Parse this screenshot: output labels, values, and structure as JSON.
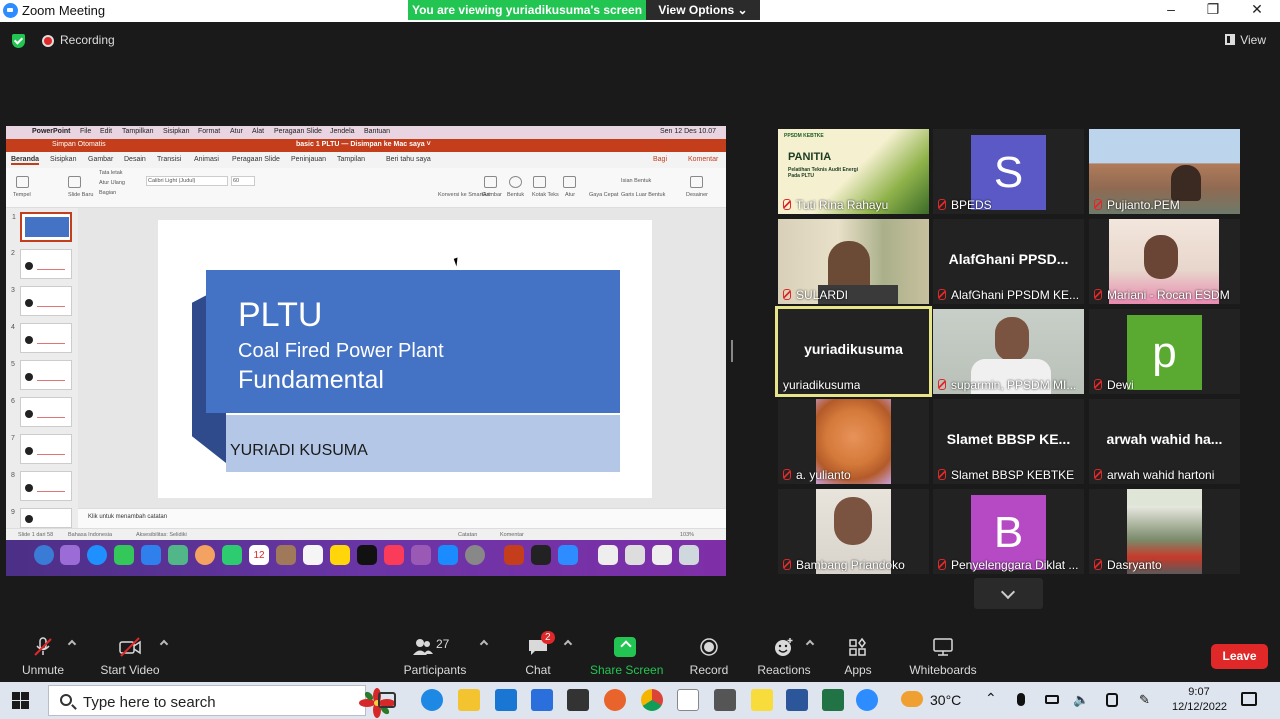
{
  "window": {
    "title": "Zoom Meeting"
  },
  "share_banner": {
    "text": "You are viewing yuriadikusuma's screen",
    "view_options": "View Options ⌄"
  },
  "window_controls": {
    "minimize": "–",
    "maximize": "❐",
    "close": "✕"
  },
  "recording": {
    "label": "Recording"
  },
  "view_button": {
    "label": "View"
  },
  "shared_screen": {
    "mac_menu": [
      "PowerPoint",
      "File",
      "Edit",
      "Tampilkan",
      "Sisipkan",
      "Format",
      "Atur",
      "Alat",
      "Peragaan Slide",
      "Jendela",
      "Bantuan"
    ],
    "mac_clock": "Sen 12 Des  10.07",
    "doc_title": "basic 1 PLTU — Disimpan ke Mac saya ˅",
    "autosave": "Simpan Otomatis",
    "ribbon_tabs": [
      "Beranda",
      "Sisipkan",
      "Gambar",
      "Desain",
      "Transisi",
      "Animasi",
      "Peragaan Slide",
      "Peninjauan",
      "Tampilan",
      "Beri tahu saya"
    ],
    "share_btn": "Bagi",
    "comment_btn": "Komentar",
    "ribbon_labels": [
      "Tempel",
      "Slide Baru",
      "Tata letak",
      "Atur Ulang",
      "Bagian",
      "Calibri Light (Judul)",
      "60",
      "Konversi ke SmartArt",
      "Gambar",
      "Bentuk",
      "Kotak Teks",
      "Atur",
      "Gaya Cepat",
      "Isian Bentuk",
      "Garis Luar Bentuk",
      "Desainer"
    ],
    "slide": {
      "title": "PLTU",
      "subtitle1": "Coal Fired Power Plant",
      "subtitle2": "Fundamental",
      "author": "YURIADI KUSUMA"
    },
    "notes_placeholder": "Klik untuk menambah catatan",
    "status": {
      "slide_count": "Slide 1 dari 58",
      "language": "Bahasa Indonesia",
      "accessibility": "Aksesibilitas: Selidiki",
      "notes": "Catatan",
      "comments": "Komentar",
      "zoom": "103%"
    },
    "thumbnail_numbers": [
      "1",
      "2",
      "3",
      "4",
      "5",
      "6",
      "7",
      "8",
      "9"
    ],
    "dock_calendar": "12"
  },
  "participants_gallery": [
    {
      "name": "Tuti Rina Rahayu",
      "type": "photo",
      "poster_title": "PANITIA",
      "poster_sub": "Pelatihan Teknis Audit Energi Pada PLTU",
      "poster_org": "PPSDM KEBTKE"
    },
    {
      "name": "BPEDS",
      "type": "avatar",
      "letter": "S",
      "color": "#5a59c6"
    },
    {
      "name": "Pujianto.PEM",
      "type": "photo"
    },
    {
      "name": "SULARDI",
      "type": "photo"
    },
    {
      "name": "AlafGhani PPSDM KE...",
      "type": "text",
      "display": "AlafGhani  PPSD..."
    },
    {
      "name": "Mariani - Rocan ESDM",
      "type": "photo"
    },
    {
      "name": "yuriadikusuma",
      "type": "text",
      "display": "yuriadikusuma",
      "speaking": true
    },
    {
      "name": "suparmin, PPSDM MI...",
      "type": "photo"
    },
    {
      "name": "Dewi",
      "type": "avatar",
      "letter": "p",
      "color": "#5aaa32"
    },
    {
      "name": "a. yulianto",
      "type": "photo"
    },
    {
      "name": "Slamet BBSP KEBTKE",
      "type": "text",
      "display": "Slamet  BBSP  KE..."
    },
    {
      "name": "arwah wahid hartoni",
      "type": "text",
      "display": "arwah  wahid  ha..."
    },
    {
      "name": "Bambang Priandoko",
      "type": "photo"
    },
    {
      "name": "Penyelenggara Diklat ...",
      "type": "avatar",
      "letter": "B",
      "color": "#b54ac4"
    },
    {
      "name": "Dasryanto",
      "type": "photo"
    }
  ],
  "toolbar": {
    "unmute": "Unmute",
    "start_video": "Start Video",
    "participants": "Participants",
    "participants_count": "27",
    "chat": "Chat",
    "chat_badge": "2",
    "share_screen": "Share Screen",
    "record": "Record",
    "reactions": "Reactions",
    "apps": "Apps",
    "whiteboards": "Whiteboards",
    "leave": "Leave"
  },
  "taskbar": {
    "search_placeholder": "Type here to search",
    "temperature": "30°C",
    "time": "9:07",
    "date": "12/12/2022"
  },
  "colors": {
    "zoom_green": "#23c552",
    "leave_red": "#e02828",
    "speaker_border": "#e7e58a",
    "ppt_orange": "#c43e1c",
    "slide_blue": "#4472c4"
  }
}
